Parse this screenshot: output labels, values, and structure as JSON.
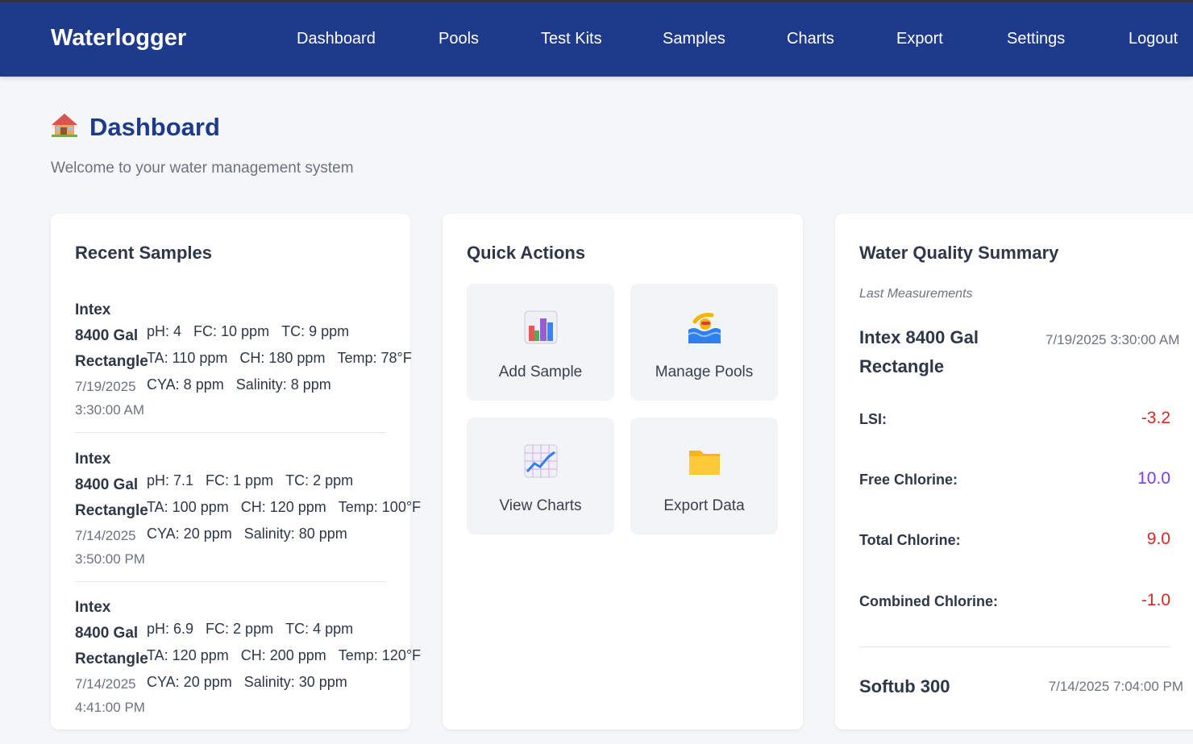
{
  "app": {
    "brand": "Waterlogger"
  },
  "nav": [
    {
      "label": "Dashboard"
    },
    {
      "label": "Pools"
    },
    {
      "label": "Test Kits"
    },
    {
      "label": "Samples"
    },
    {
      "label": "Charts"
    },
    {
      "label": "Export"
    },
    {
      "label": "Settings"
    },
    {
      "label": "Logout"
    }
  ],
  "page": {
    "title": "Dashboard",
    "title_icon": "house-icon",
    "subtitle": "Welcome to your water management system"
  },
  "recent_samples": {
    "title": "Recent Samples",
    "items": [
      {
        "pool_l1": "Intex",
        "pool_l2": "8400 Gal",
        "pool_l3": "Rectangle",
        "date": "7/19/2025",
        "time": "3:30:00 AM",
        "ph": "pH: 4",
        "fc": "FC: 10 ppm",
        "tc": "TC: 9 ppm",
        "ta": "TA: 110 ppm",
        "ch": "CH: 180 ppm",
        "temp": "Temp: 78°F",
        "cya": "CYA: 8 ppm",
        "salinity": "Salinity: 8 ppm"
      },
      {
        "pool_l1": "Intex",
        "pool_l2": "8400 Gal",
        "pool_l3": "Rectangle",
        "date": "7/14/2025",
        "time": "3:50:00 PM",
        "ph": "pH: 7.1",
        "fc": "FC: 1 ppm",
        "tc": "TC: 2 ppm",
        "ta": "TA: 100 ppm",
        "ch": "CH: 120 ppm",
        "temp": "Temp: 100°F",
        "cya": "CYA: 20 ppm",
        "salinity": "Salinity: 80 ppm"
      },
      {
        "pool_l1": "Intex",
        "pool_l2": "8400 Gal",
        "pool_l3": "Rectangle",
        "date": "7/14/2025",
        "time": "4:41:00 PM",
        "ph": "pH: 6.9",
        "fc": "FC: 2 ppm",
        "tc": "TC: 4 ppm",
        "ta": "TA: 120 ppm",
        "ch": "CH: 200 ppm",
        "temp": "Temp: 120°F",
        "cya": "CYA: 20 ppm",
        "salinity": "Salinity: 30 ppm"
      }
    ]
  },
  "quick_actions": {
    "title": "Quick Actions",
    "items": [
      {
        "label": "Add Sample",
        "icon": "bar-chart-icon"
      },
      {
        "label": "Manage Pools",
        "icon": "swimmer-icon"
      },
      {
        "label": "View Charts",
        "icon": "line-chart-icon"
      },
      {
        "label": "Export Data",
        "icon": "folder-icon"
      }
    ]
  },
  "water_quality": {
    "title": "Water Quality Summary",
    "meta": "Last Measurements",
    "pool1": {
      "name": "Intex 8400 Gal Rectangle",
      "date": "7/19/2025 3:30:00 AM"
    },
    "rows": [
      {
        "label": "LSI:",
        "value": "-3.2",
        "color": "#dc2626"
      },
      {
        "label": "Free Chlorine:",
        "value": "10.0",
        "color": "#7c3aed"
      },
      {
        "label": "Total Chlorine:",
        "value": "9.0",
        "color": "#dc2626"
      },
      {
        "label": "Combined Chlorine:",
        "value": "-1.0",
        "color": "#dc2626"
      }
    ],
    "pool2": {
      "name": "Softub 300",
      "date": "7/14/2025 7:04:00 PM"
    }
  },
  "colors": {
    "navbar": "#1e3a8a",
    "title": "#1e3a8a",
    "bad": "#dc2626",
    "high": "#7c3aed"
  }
}
